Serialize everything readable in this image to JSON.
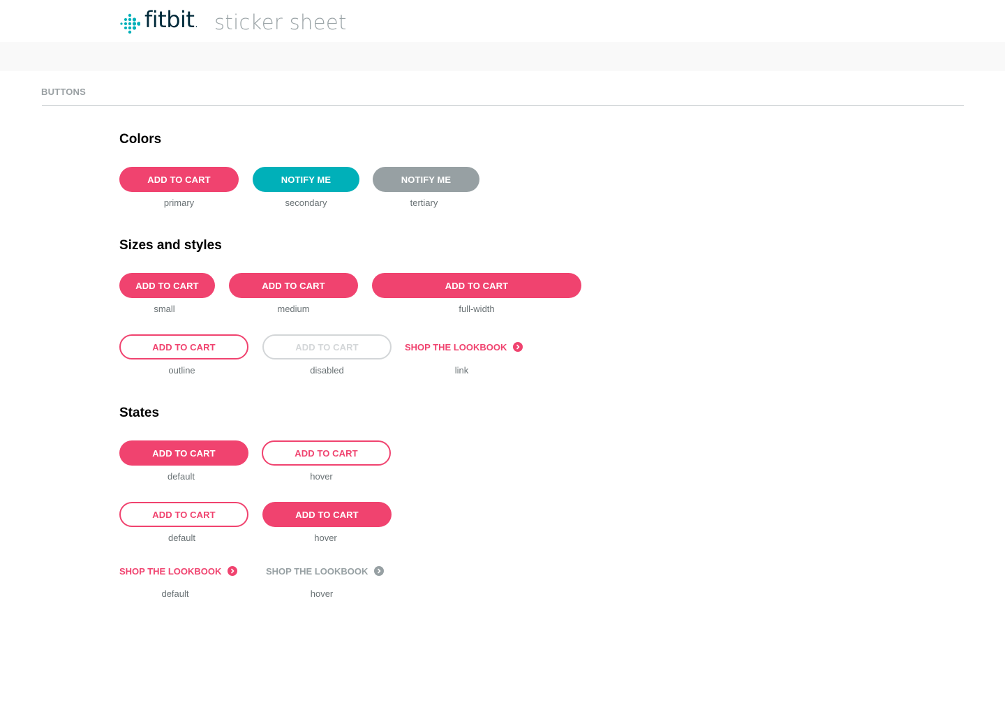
{
  "header": {
    "brand": "fitbit",
    "title": "sticker sheet"
  },
  "colors": {
    "primary": "#f0436f",
    "secondary": "#00b0b9",
    "tertiary": "#97a0a3",
    "disabled": "#d3d6d8",
    "logo_teal": "#00b0b9",
    "logo_text": "#002a3a"
  },
  "section": {
    "label": "BUTTONS"
  },
  "colors_group": {
    "heading": "Colors",
    "items": [
      {
        "label": "ADD TO CART",
        "caption": "primary"
      },
      {
        "label": "NOTIFY ME",
        "caption": "secondary"
      },
      {
        "label": "NOTIFY ME",
        "caption": "tertiary"
      }
    ]
  },
  "sizes_group": {
    "heading": "Sizes and styles",
    "sizes": [
      {
        "label": "ADD TO CART",
        "caption": "small"
      },
      {
        "label": "ADD TO CART",
        "caption": "medium"
      },
      {
        "label": "ADD TO CART",
        "caption": "full-width"
      }
    ],
    "styles": [
      {
        "label": "ADD TO CART",
        "caption": "outline"
      },
      {
        "label": "ADD TO CART",
        "caption": "disabled"
      },
      {
        "label": "SHOP THE LOOKBOOK",
        "caption": "link",
        "icon": "chevron-right-circle-icon"
      }
    ]
  },
  "states_group": {
    "heading": "States",
    "rows": [
      [
        {
          "label": "ADD TO CART",
          "caption": "default"
        },
        {
          "label": "ADD TO CART",
          "caption": "hover"
        }
      ],
      [
        {
          "label": "ADD TO CART",
          "caption": "default"
        },
        {
          "label": "ADD TO CART",
          "caption": "hover"
        }
      ],
      [
        {
          "label": "SHOP THE LOOKBOOK",
          "caption": "default",
          "icon": "chevron-right-circle-icon"
        },
        {
          "label": "SHOP THE LOOKBOOK",
          "caption": "hover",
          "icon": "chevron-right-circle-icon"
        }
      ]
    ]
  }
}
